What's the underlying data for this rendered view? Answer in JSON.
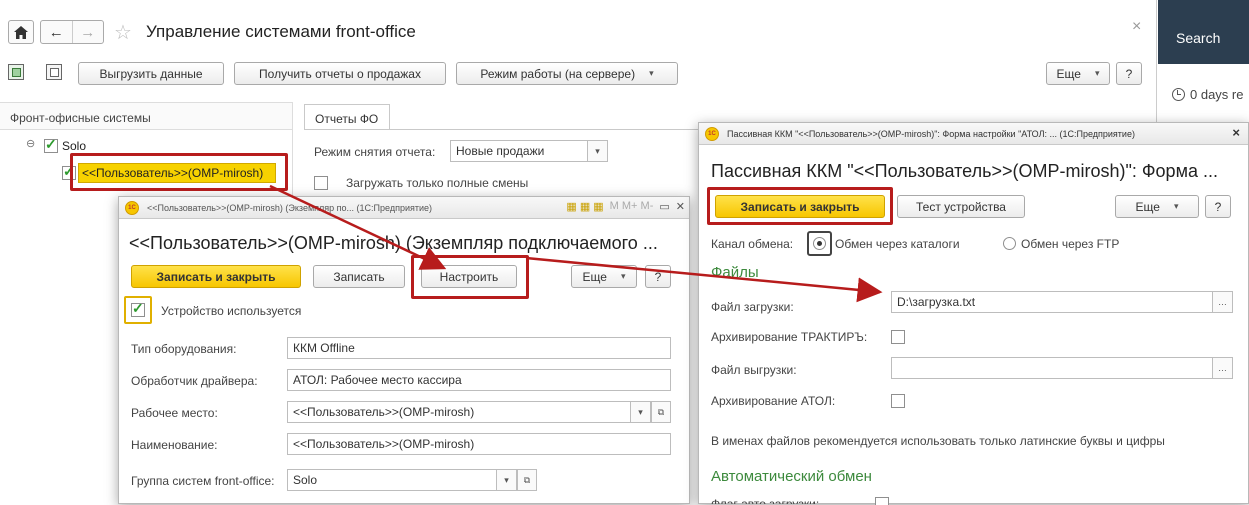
{
  "main": {
    "title": "Управление системами front-office",
    "close": "×",
    "toolbar": {
      "export_label": "Выгрузить данные",
      "get_reports_label": "Получить отчеты о продажах",
      "mode_label": "Режим работы (на сервере)",
      "more_label": "Еще",
      "help_label": "?"
    },
    "left_panel": {
      "header": "Фронт-офисные системы",
      "tree_root": "Solo",
      "tree_child": "<<Пользователь>>(OMP-mirosh)"
    },
    "tab": "Отчеты ФО",
    "report_mode_label": "Режим снятия отчета:",
    "report_mode_value": "Новые продажи",
    "full_shifts_label": "Загружать только полные смены"
  },
  "side_panel": {
    "search_label": "Search",
    "days_label": "0 days re"
  },
  "device_window": {
    "titlebar": "<<Пользователь>>(OMP-mirosh) (Экземпляр по... (1С:Предприятие)",
    "title": "<<Пользователь>>(OMP-mirosh) (Экземпляр подключаемого ...",
    "save_close_label": "Записать и закрыть",
    "save_label": "Записать",
    "configure_label": "Настроить",
    "more_label": "Еще",
    "help_label": "?",
    "device_used_label": "Устройство используется",
    "fields": {
      "type_label": "Тип оборудования:",
      "type_value": "ККМ Offline",
      "driver_label": "Обработчик драйвера:",
      "driver_value": "АТОЛ: Рабочее место кассира",
      "workplace_label": "Рабочее место:",
      "workplace_value": "<<Пользователь>>(OMP-mirosh)",
      "name_label": "Наименование:",
      "name_value": "<<Пользователь>>(OMP-mirosh)",
      "group_label": "Группа систем front-office:",
      "group_value": "Solo"
    }
  },
  "settings_window": {
    "titlebar": "Пассивная ККМ \"<<Пользователь>>(OMP-mirosh)\": Форма настройки \"АТОЛ: ... (1С:Предприятие)",
    "close": "×",
    "title": "Пассивная ККМ \"<<Пользователь>>(OMP-mirosh)\": Форма ...",
    "save_close_label": "Записать и закрыть",
    "test_label": "Тест устройства",
    "more_label": "Еще",
    "help_label": "?",
    "channel_label": "Канал обмена:",
    "channel_catalog": "Обмен через каталоги",
    "channel_ftp": "Обмен через FTP",
    "files_section": "Файлы",
    "load_file_label": "Файл загрузки:",
    "load_file_value": "D:\\загрузка.txt",
    "archive_trakt_label": "Архивирование ТРАКТИРЪ:",
    "export_file_label": "Файл выгрузки:",
    "archive_atol_label": "Архивирование АТОЛ:",
    "hint": "В именах файлов рекомендуется использовать только латинские буквы и цифры",
    "auto_section": "Автоматический обмен",
    "auto_flag_label": "Флаг авто загрузки:"
  },
  "colors": {
    "accent_yellow": "#f7c600",
    "annotation_red": "#b71c1c",
    "section_green": "#3d8a3d",
    "side_dark": "#2c3e50"
  }
}
